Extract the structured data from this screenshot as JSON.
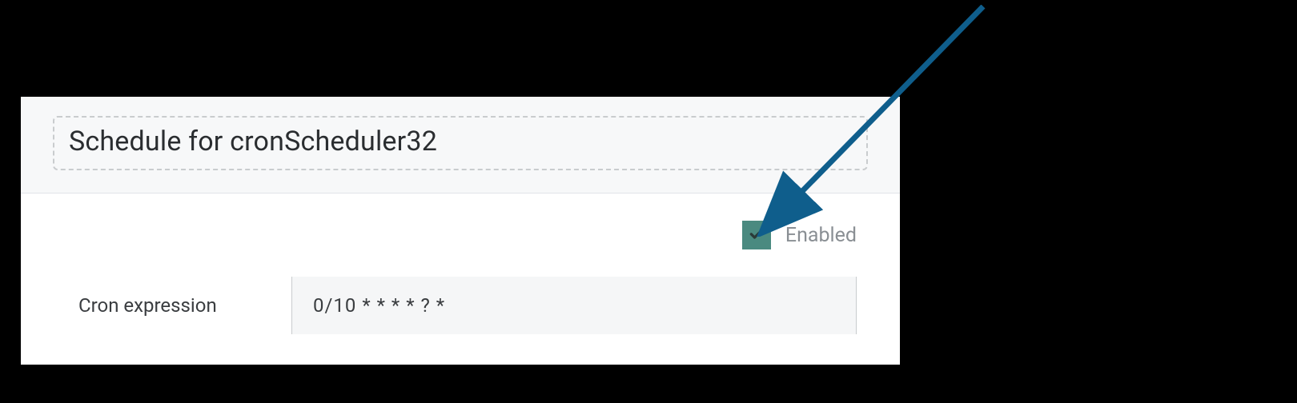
{
  "header": {
    "title_value": "Schedule for cronScheduler32"
  },
  "form": {
    "enabled_label": "Enabled",
    "enabled_checked": true,
    "cron_label": "Cron expression",
    "cron_value": "0/10 * * * * ? *"
  },
  "colors": {
    "checkbox_bg": "#4a8a80",
    "arrow": "#0f5e8c"
  }
}
